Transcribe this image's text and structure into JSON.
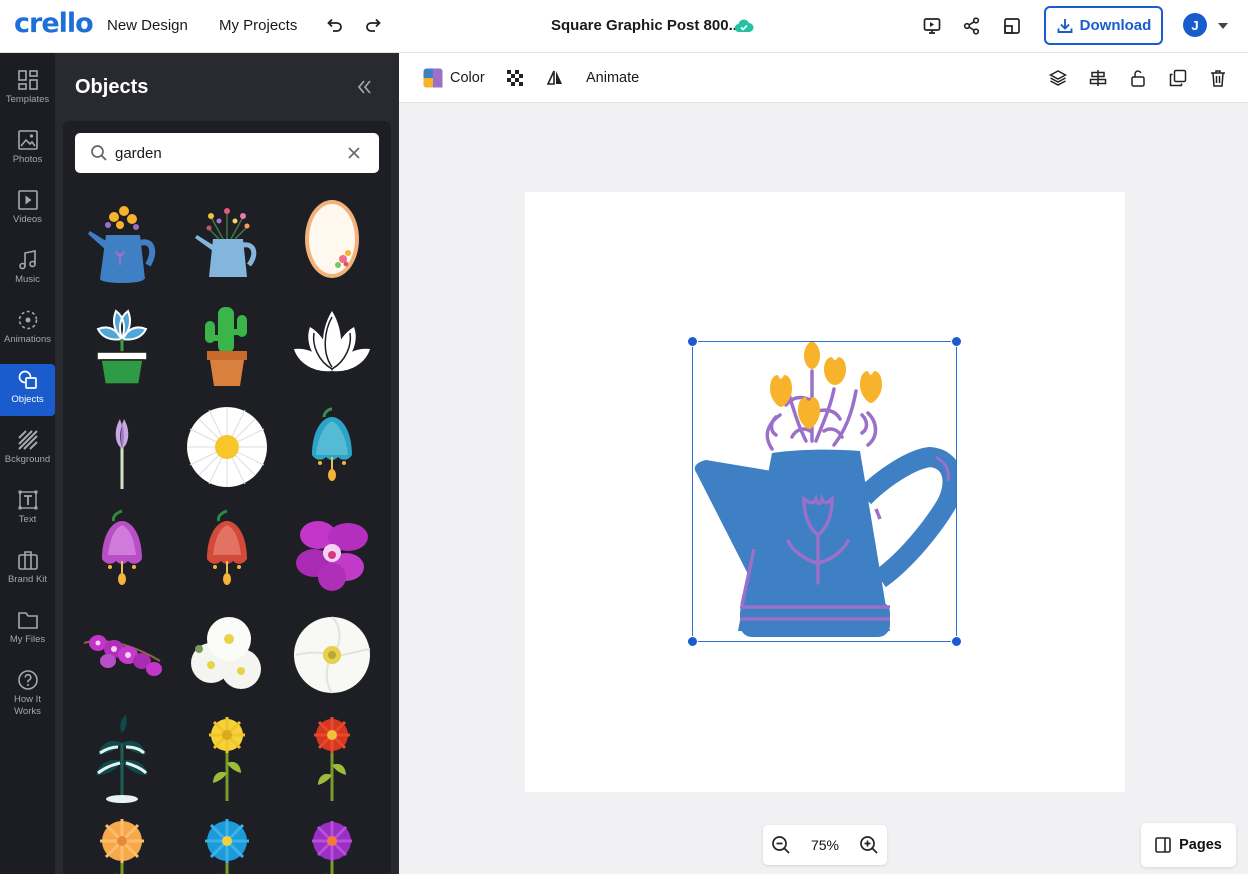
{
  "brand": {
    "logo_text": "crello",
    "accent": "#1a5ccd"
  },
  "header": {
    "new_design": "New Design",
    "my_projects": "My Projects",
    "title": "Square Graphic Post 800...",
    "download": "Download",
    "avatar_initial": "J"
  },
  "rail": [
    {
      "label": "Templates",
      "icon": "templates-icon"
    },
    {
      "label": "Photos",
      "icon": "photos-icon"
    },
    {
      "label": "Videos",
      "icon": "videos-icon"
    },
    {
      "label": "Music",
      "icon": "music-icon"
    },
    {
      "label": "Animations",
      "icon": "animations-icon"
    },
    {
      "label": "Objects",
      "icon": "objects-icon",
      "active": true
    },
    {
      "label": "Bckground",
      "icon": "background-icon"
    },
    {
      "label": "Text",
      "icon": "text-icon"
    },
    {
      "label": "Brand Kit",
      "icon": "brand-kit-icon"
    },
    {
      "label": "My Files",
      "icon": "folder-icon"
    },
    {
      "label": "How It Works",
      "icon": "help-icon"
    }
  ],
  "panel": {
    "title": "Objects",
    "search_value": "garden",
    "thumbnails": [
      "watering-can-yellow-flowers",
      "watering-can-wildflowers",
      "oval-floral-frame",
      "potted-pinwheel-plant",
      "potted-cactus",
      "white-lotus",
      "purple-crocus",
      "white-daisy",
      "blue-bellflower",
      "purple-bellflower",
      "red-bellflower",
      "purple-orchid",
      "orchid-branch",
      "white-flower-cluster",
      "white-flower",
      "snowy-shrub",
      "yellow-flower-stem",
      "red-flower-stem",
      "orange-flower",
      "blue-flower",
      "magenta-flower"
    ]
  },
  "toolbar": {
    "color": "Color",
    "animate": "Animate"
  },
  "zoom": {
    "level": "75%"
  },
  "pages": {
    "label": "Pages"
  }
}
